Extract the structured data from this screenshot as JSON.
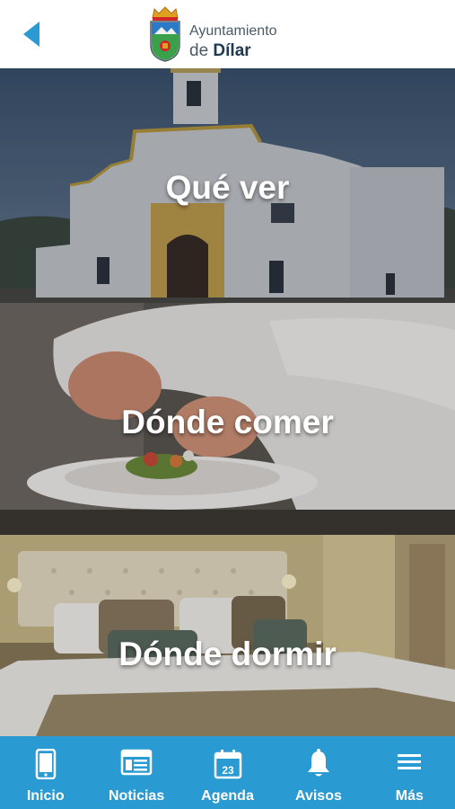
{
  "header": {
    "logo_line1": "Ayuntamiento",
    "logo_line2_prefix": "de ",
    "logo_line2_name": "Dílar"
  },
  "sections": [
    {
      "title": "Qué ver"
    },
    {
      "title": "Dónde comer"
    },
    {
      "title": "Dónde dormir"
    }
  ],
  "nav": {
    "items": [
      {
        "label": "Inicio",
        "icon": "phone-icon"
      },
      {
        "label": "Noticias",
        "icon": "newspaper-icon"
      },
      {
        "label": "Agenda",
        "icon": "calendar-icon"
      },
      {
        "label": "Avisos",
        "icon": "bell-icon"
      },
      {
        "label": "Más",
        "icon": "menu-icon"
      }
    ],
    "calendar_day": "23"
  },
  "colors": {
    "accent": "#2a9ad2",
    "back_arrow": "#2a9ad2",
    "logo_text": "#4a5a68"
  }
}
